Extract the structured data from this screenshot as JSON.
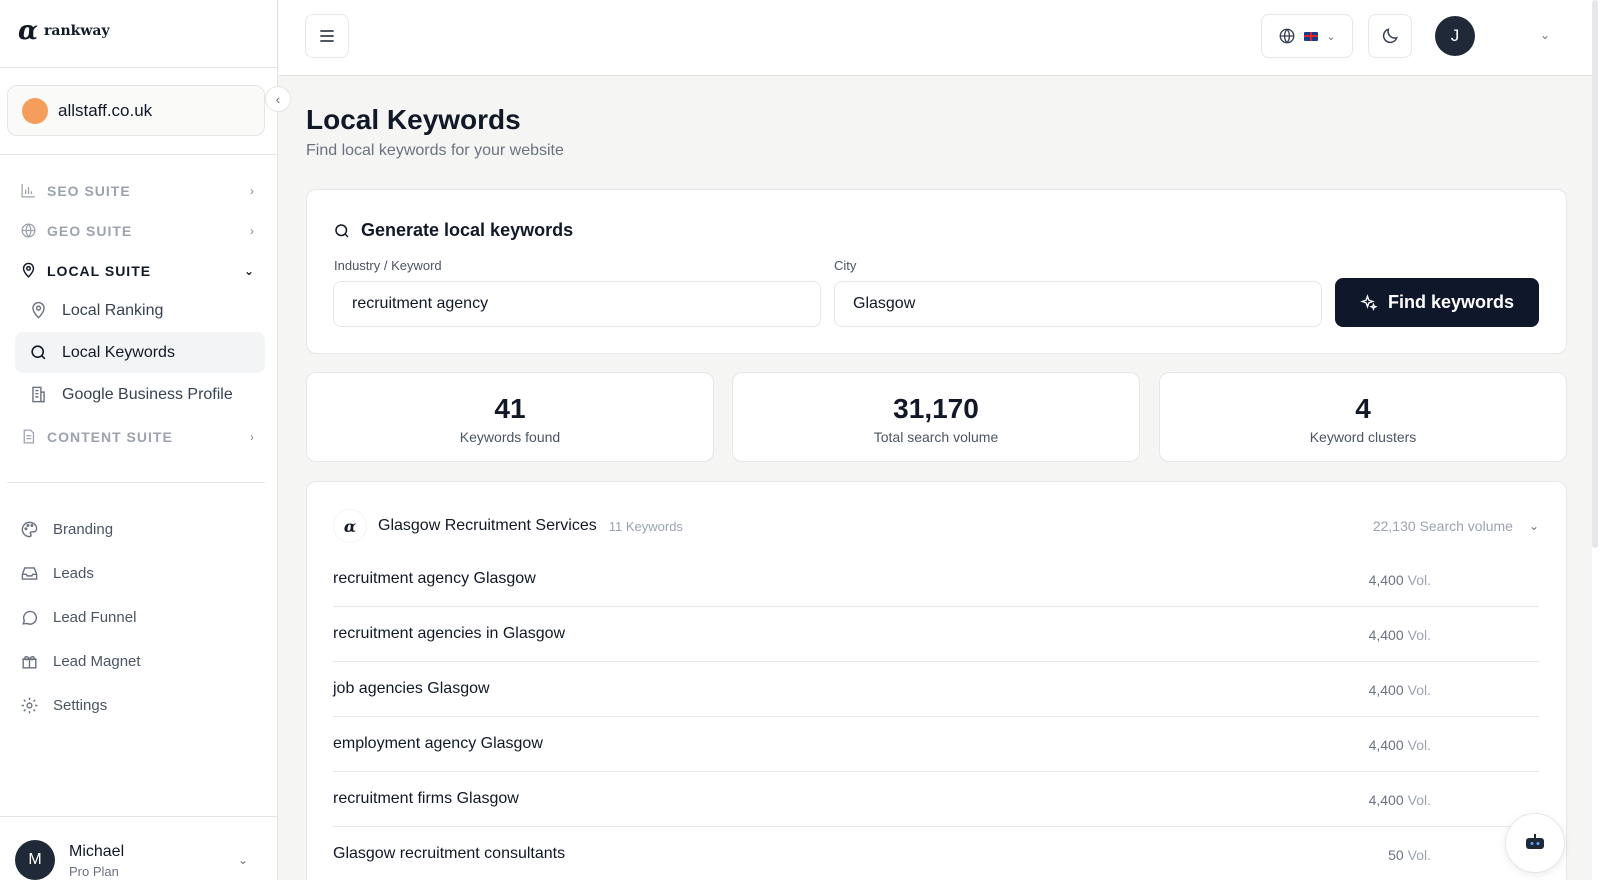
{
  "brand": {
    "name": "rankway",
    "mark": "α"
  },
  "site": {
    "name": "allstaff.co.uk"
  },
  "nav": {
    "sections": [
      {
        "label": "SEO SUITE",
        "icon": "bar-chart-icon",
        "expanded": false
      },
      {
        "label": "GEO SUITE",
        "icon": "globe-icon",
        "expanded": false
      },
      {
        "label": "LOCAL SUITE",
        "icon": "map-pin-icon",
        "expanded": true
      },
      {
        "label": "CONTENT SUITE",
        "icon": "document-icon",
        "expanded": false
      }
    ],
    "local_items": [
      {
        "label": "Local Ranking",
        "icon": "map-pin-icon",
        "active": false
      },
      {
        "label": "Local Keywords",
        "icon": "search-icon",
        "active": true
      },
      {
        "label": "Google Business Profile",
        "icon": "building-icon",
        "active": false
      }
    ],
    "extra": [
      {
        "label": "Branding",
        "icon": "palette-icon"
      },
      {
        "label": "Leads",
        "icon": "inbox-icon"
      },
      {
        "label": "Lead Funnel",
        "icon": "chat-icon"
      },
      {
        "label": "Lead Magnet",
        "icon": "gift-icon"
      },
      {
        "label": "Settings",
        "icon": "gear-icon"
      }
    ]
  },
  "user": {
    "initial": "M",
    "name": "Michael",
    "plan": "Pro Plan"
  },
  "header": {
    "avatar_initial": "J"
  },
  "page": {
    "title": "Local Keywords",
    "subtitle": "Find local keywords for your website"
  },
  "generator": {
    "title": "Generate local keywords",
    "industry_label": "Industry / Keyword",
    "industry_value": "recruitment agency",
    "city_label": "City",
    "city_value": "Glasgow",
    "button_label": "Find keywords"
  },
  "stats": [
    {
      "value": "41",
      "label": "Keywords found"
    },
    {
      "value": "31,170",
      "label": "Total search volume"
    },
    {
      "value": "4",
      "label": "Keyword clusters"
    }
  ],
  "cluster": {
    "name": "Glasgow Recruitment Services",
    "count": "11 Keywords",
    "volume": "22,130 Search volume",
    "keywords": [
      {
        "text": "recruitment agency Glasgow",
        "volume": "4,400",
        "unit": "Vol."
      },
      {
        "text": "recruitment agencies in Glasgow",
        "volume": "4,400",
        "unit": "Vol."
      },
      {
        "text": "job agencies Glasgow",
        "volume": "4,400",
        "unit": "Vol."
      },
      {
        "text": "employment agency Glasgow",
        "volume": "4,400",
        "unit": "Vol."
      },
      {
        "text": "recruitment firms Glasgow",
        "volume": "4,400",
        "unit": "Vol."
      },
      {
        "text": "Glasgow recruitment consultants",
        "volume": "50",
        "unit": "Vol."
      }
    ]
  },
  "colors": {
    "primary_button": "#0f172a",
    "site_dot": "#f59e5b",
    "avatar": "#1f2937"
  }
}
